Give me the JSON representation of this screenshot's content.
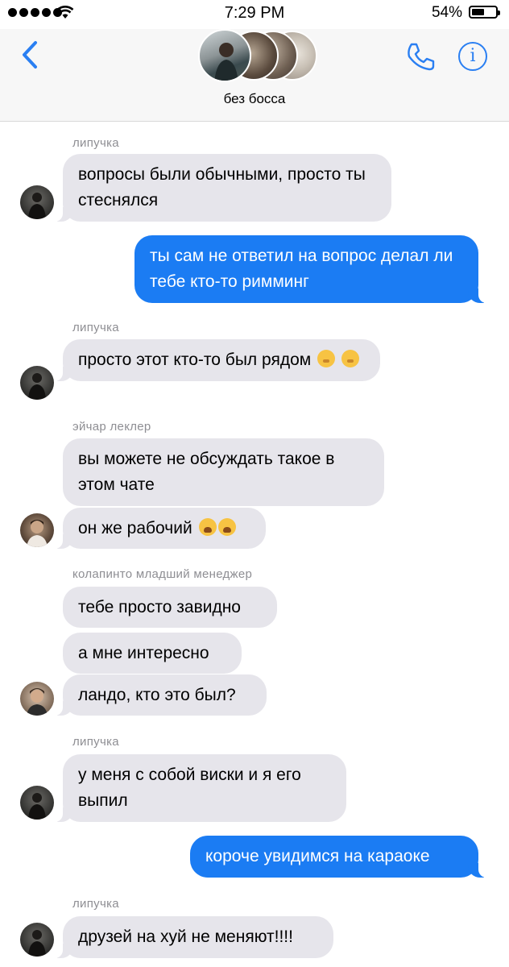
{
  "status_bar": {
    "time": "7:29 PM",
    "battery_percent_label": "54%",
    "battery_level": 0.54
  },
  "header": {
    "group_name": "без босса",
    "back_icon": "chevron-left-icon",
    "call_icon": "phone-icon",
    "info_icon": "info-icon",
    "info_glyph": "i",
    "accent_color": "#2a7ff2"
  },
  "colors": {
    "incoming_bubble": "#e6e5eb",
    "outgoing_bubble": "#1b7cf3",
    "sender_label": "#8e8e93"
  },
  "messages": [
    {
      "sender": "липучка",
      "text": "вопросы были обычными, просто ты стеснялся",
      "direction": "incoming"
    },
    {
      "text": "ты сам не ответил на вопрос делал ли тебе кто-то римминг",
      "direction": "outgoing"
    },
    {
      "sender": "липучка",
      "text": "просто этот кто-то был рядом",
      "emoji": "face-with-hand-over-mouth",
      "direction": "incoming"
    },
    {
      "sender": "эйчар леклер",
      "text": "вы можете не обсуждать такое в этом чате",
      "direction": "incoming"
    },
    {
      "text": "он же рабочий",
      "emoji": "weary-face",
      "direction": "incoming"
    },
    {
      "sender": "колапинто младший менеджер",
      "text": "тебе просто завидно",
      "direction": "incoming"
    },
    {
      "text": "а мне интересно",
      "direction": "incoming"
    },
    {
      "text": "ландо, кто это был?",
      "direction": "incoming"
    },
    {
      "sender": "липучка",
      "text": "у меня с собой виски и я его выпил",
      "direction": "incoming"
    },
    {
      "text": "короче увидимся на караоке",
      "direction": "outgoing"
    },
    {
      "sender": "липучка",
      "text": "друзей на хуй не меняют!!!!",
      "direction": "incoming"
    }
  ]
}
